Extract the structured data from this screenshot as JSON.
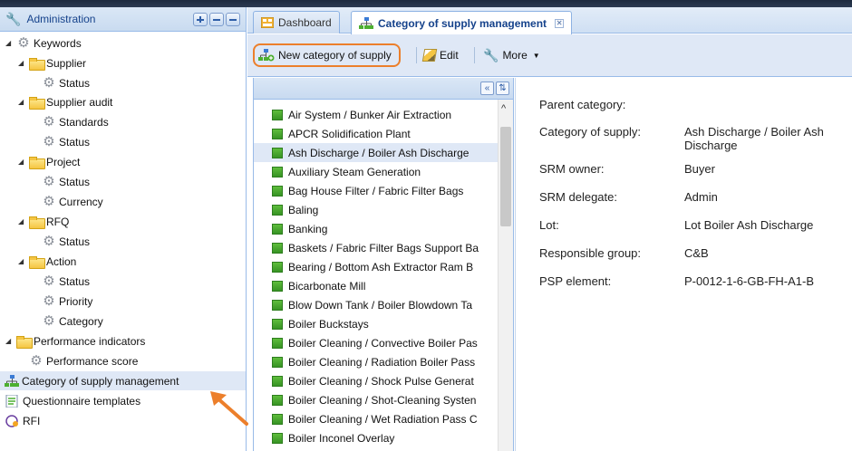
{
  "left_panel": {
    "title": "Administration",
    "tree": [
      {
        "label": "Keywords",
        "icon": "gear-icon",
        "level": 0,
        "expanded": true
      },
      {
        "label": "Supplier",
        "icon": "folder-icon",
        "level": 1,
        "expanded": true
      },
      {
        "label": "Status",
        "icon": "gear-icon",
        "level": 2
      },
      {
        "label": "Supplier audit",
        "icon": "folder-icon",
        "level": 1,
        "expanded": true
      },
      {
        "label": "Standards",
        "icon": "gear-icon",
        "level": 2
      },
      {
        "label": "Status",
        "icon": "gear-icon",
        "level": 2
      },
      {
        "label": "Project",
        "icon": "folder-icon",
        "level": 1,
        "expanded": true
      },
      {
        "label": "Status",
        "icon": "gear-icon",
        "level": 2
      },
      {
        "label": "Currency",
        "icon": "gear-icon",
        "level": 2
      },
      {
        "label": "RFQ",
        "icon": "folder-icon",
        "level": 1,
        "expanded": true
      },
      {
        "label": "Status",
        "icon": "gear-icon",
        "level": 2
      },
      {
        "label": "Action",
        "icon": "folder-icon",
        "level": 1,
        "expanded": true
      },
      {
        "label": "Status",
        "icon": "gear-icon",
        "level": 2
      },
      {
        "label": "Priority",
        "icon": "gear-icon",
        "level": 2
      },
      {
        "label": "Category",
        "icon": "gear-icon",
        "level": 2
      },
      {
        "label": "Performance indicators",
        "icon": "folder-icon",
        "level": 0,
        "expanded": true
      },
      {
        "label": "Performance score",
        "icon": "gear-icon",
        "level": 1
      },
      {
        "label": "Category of supply management",
        "icon": "org-chart-icon",
        "level": 0,
        "selected": true
      },
      {
        "label": "Questionnaire templates",
        "icon": "questionnaire-icon",
        "level": 0
      },
      {
        "label": "RFI",
        "icon": "rfi-icon",
        "level": 0
      }
    ]
  },
  "tabs": {
    "dashboard": "Dashboard",
    "active": "Category of supply management"
  },
  "toolbar": {
    "new_label": "New category of supply",
    "edit_label": "Edit",
    "more_label": "More"
  },
  "list": {
    "items": [
      "Air System / Bunker Air Extraction",
      "APCR Solidification Plant",
      "Ash Discharge / Boiler Ash Discharge",
      "Auxiliary Steam Generation",
      "Bag House Filter / Fabric Filter Bags",
      "Baling",
      "Banking",
      "Baskets / Fabric Filter Bags Support Ba",
      "Bearing / Bottom Ash Extractor Ram B",
      "Bicarbonate Mill",
      "Blow Down Tank / Boiler Blowdown Ta",
      "Boiler Buckstays",
      "Boiler Cleaning / Convective Boiler Pas",
      "Boiler Cleaning / Radiation Boiler Pass",
      "Boiler Cleaning / Shock Pulse Generat",
      "Boiler Cleaning / Shot-Cleaning Systen",
      "Boiler Cleaning / Wet Radiation Pass C",
      "Boiler Inconel Overlay"
    ],
    "selected_index": 2
  },
  "detail": {
    "rows": [
      {
        "label": "Parent category:",
        "value": ""
      },
      {
        "label": "Category of supply:",
        "value": "Ash Discharge / Boiler Ash Discharge"
      },
      {
        "label": "SRM owner:",
        "value": "Buyer"
      },
      {
        "label": "SRM delegate:",
        "value": "Admin"
      },
      {
        "label": "Lot:",
        "value": "Lot Boiler Ash Discharge"
      },
      {
        "label": "Responsible group:",
        "value": "C&B"
      },
      {
        "label": "PSP element:",
        "value": "P-0012-1-6-GB-FH-A1-B"
      }
    ]
  },
  "colors": {
    "accent": "#15428b",
    "highlight_outline": "#ec7f2b",
    "selection": "#dfe8f6",
    "item_square": "#4caf30"
  }
}
